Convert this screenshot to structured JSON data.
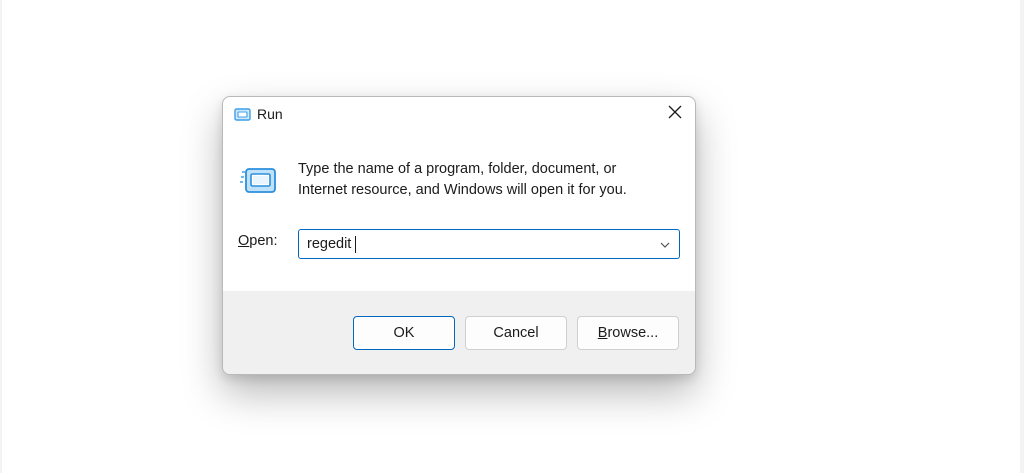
{
  "window": {
    "title": "Run",
    "app_icon": "run-icon",
    "close_icon": "close-icon"
  },
  "dialog": {
    "description_line1": "Type the name of a program, folder, document, or",
    "description_line2": "Internet resource, and Windows will open it for you.",
    "open_label_mnemonic": "O",
    "open_label_rest": "pen:",
    "input_value": "regedit",
    "dropdown_icon": "chevron-down-icon"
  },
  "buttons": {
    "ok_label": "OK",
    "cancel_label": "Cancel",
    "browse_mnemonic": "B",
    "browse_rest": "rowse..."
  },
  "colors": {
    "accent": "#0067c0",
    "icon_blue": "#3ca0e8",
    "footer_bg": "#f0f0f0"
  }
}
